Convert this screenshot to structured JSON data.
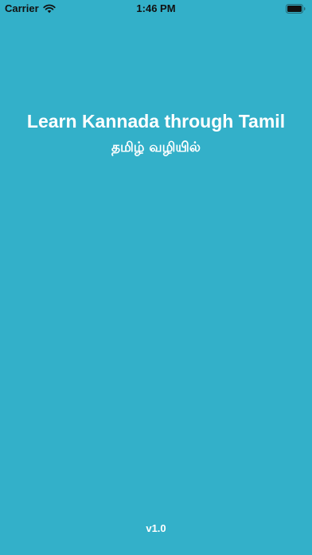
{
  "status_bar": {
    "carrier": "Carrier",
    "time": "1:46 PM",
    "icons": [
      "wifi-icon",
      "battery-icon"
    ]
  },
  "splash": {
    "title": "Learn Kannada through Tamil",
    "subtitle": "தமிழ் வழியில்",
    "version": "v1.0"
  },
  "colors": {
    "background": "#33b0c9",
    "text": "#ffffff",
    "status_text": "#111111"
  }
}
